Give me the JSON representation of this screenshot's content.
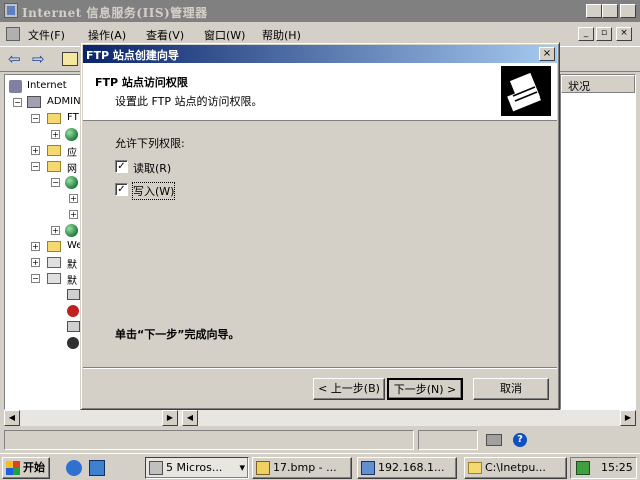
{
  "main_window": {
    "title": "Internet 信息服务(IIS)管理器",
    "min_glyph": "_",
    "max_glyph": "□",
    "close_glyph": "×"
  },
  "menu": {
    "items": [
      "文件(F)",
      "操作(A)",
      "查看(V)",
      "窗口(W)",
      "帮助(H)"
    ],
    "child_min_glyph": "_",
    "child_max_glyph": "▫",
    "child_close_glyph": "×"
  },
  "toolbar": {
    "back_glyph": "⇦",
    "forward_glyph": "⇨"
  },
  "tree": {
    "rows": [
      "Internet",
      "ADMIN",
      "FT",
      "",
      "应",
      "网",
      "",
      "",
      "",
      "",
      "We",
      "默",
      "默"
    ]
  },
  "list_pane": {
    "column_header": "状况"
  },
  "dialog": {
    "title": "FTP 站点创建向导",
    "close_glyph": "×",
    "heading": "FTP 站点访问权限",
    "subheading": "设置此 FTP 站点的访问权限。",
    "group_label": "允许下列权限:",
    "checkboxes": [
      {
        "label": "读取(R)",
        "checked": true
      },
      {
        "label": "写入(W)",
        "checked": true
      }
    ],
    "finish_hint": "单击“下一步”完成向导。",
    "back_button": "< 上一步(B)",
    "next_button": "下一步(N) >",
    "cancel_button": "取消"
  },
  "scrollbar": {
    "left_glyph": "◀",
    "right_glyph": "▶"
  },
  "status": {
    "help_glyph": "?"
  },
  "taskbar": {
    "start_label": "开始",
    "tasks": [
      {
        "label": "5 Micros...",
        "arrow": "▾"
      },
      {
        "label": "17.bmp - ..."
      },
      {
        "label": "192.168.1..."
      },
      {
        "label": "C:\\Inetpu..."
      }
    ],
    "clock": "15:25"
  },
  "colors": {
    "dialog_title_start": "#0a246a",
    "dialog_title_end": "#a6caf0",
    "face": "#d4d0c8"
  }
}
